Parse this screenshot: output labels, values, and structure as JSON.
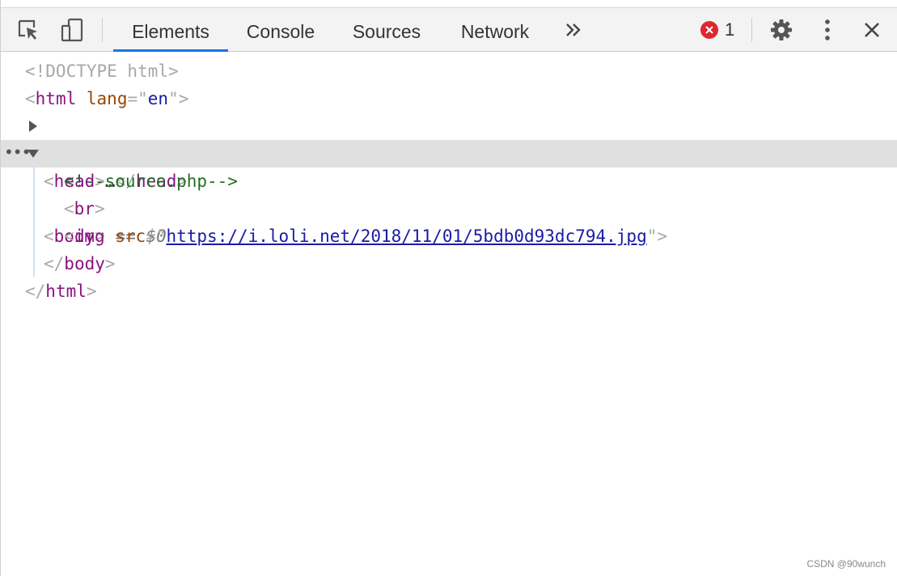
{
  "toolbar": {
    "tabs": [
      "Elements",
      "Console",
      "Sources",
      "Network"
    ],
    "active_tab": "Elements",
    "more_tabs": "»",
    "error_count": "1",
    "icons": {
      "inspect": "inspect-element-icon",
      "device": "device-toolbar-icon",
      "more": "chevron-double-right-icon",
      "error": "error-circle-icon",
      "settings": "gear-icon",
      "menu": "kebab-menu-icon",
      "close": "close-icon"
    }
  },
  "tree": {
    "doctype": "<!DOCTYPE html>",
    "html_open_tag": "html",
    "html_lang_attr": "lang",
    "html_lang_value": "en",
    "head_tag": "head",
    "head_ellipsis": "…",
    "body_tag": "body",
    "selected_marker": "== $0",
    "comment": "<!--source.php-->",
    "br_tag": "br",
    "img_tag": "img",
    "img_src_attr": "src",
    "img_src_value": "https://i.loli.net/2018/11/01/5bdb0d93dc794.jpg",
    "body_close_tag": "body",
    "html_close_tag": "html",
    "selection_dots": "•••"
  },
  "watermark": "CSDN @90wunch",
  "colors": {
    "accent": "#1a73e8",
    "tag": "#881280",
    "attr_name": "#994500",
    "attr_value": "#1a1aa6",
    "comment": "#236e25",
    "error": "#e0262f",
    "selection_bg": "#e0e0e0"
  }
}
